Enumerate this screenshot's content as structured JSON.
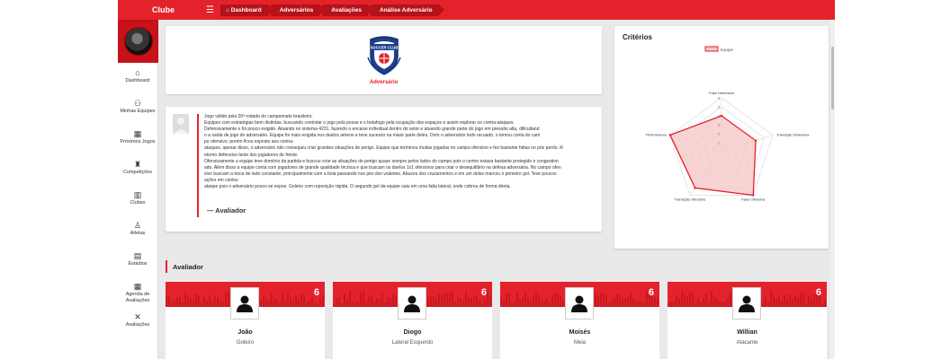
{
  "app": {
    "title": "Clube"
  },
  "breadcrumbs": [
    "Dashboard",
    "Adversários",
    "Avaliações",
    "Análise Adversário"
  ],
  "sidebar": {
    "items": [
      {
        "label": "Dashboard",
        "icon": "home-icon"
      },
      {
        "label": "Minhas Equipes",
        "icon": "team-icon"
      },
      {
        "label": "Próximos Jogos",
        "icon": "calendar-icon"
      },
      {
        "label": "Competições",
        "icon": "trophy-icon"
      },
      {
        "label": "Clubes",
        "icon": "building-icon"
      },
      {
        "label": "Atletas",
        "icon": "person-icon"
      },
      {
        "label": "Estádios",
        "icon": "stadium-icon"
      },
      {
        "label": "Agenda de Avaliações",
        "icon": "agenda-icon"
      },
      {
        "label": "Avaliações",
        "icon": "tools-icon"
      }
    ]
  },
  "opponent": {
    "label": "Adversário",
    "logo_text": "SOCCER CLUB"
  },
  "report": {
    "lines": [
      "Jogo válido pela 20ª rodada do campeonato brasileiro.",
      "Equipes com estratégias bem distintas.                     buscando controlar o jogo pela posse e o botafogo pela ocupação dos espaços e assim explorar os contra-ataques.",
      "Defensivamente o                     foi pouco exigido.  Atuando no sistema 4231, fazendo o encaixe individual dentro do setor e atuando grande parte do jogo em pressão alta, dificultand",
      "o a saída de jogo do adversário. Equipe foi mais exigida nos duelos aéreos e teve sucesso na maior parte deles.  Dom o adversário todo recuado, o                    tomou conta do cam",
      "po ofensivo, porém ficou exposto aos contra-",
      "ataques, apesar disso, o adversário não conseguiu criar grandes situações de perigo. Equipe que terminou muitas jogadas no campo ofensivo e fez bastante faltas no pós perdo. R",
      "etorno defensivo lento dos jogadores de frente.",
      "Ofensivamente a equipe teve domínio da partida e buscou criar as situações de perigo quase sempre pelos lados do campo pois o centro estava bastante protegido e congestion",
      "ado. Além disso a equipe conta com jogadores de grande qualidade técnica e que buscam os duelos 1x1 ofensivos para criar o desequilíbrio na defesa adversária. No campo ofen",
      "sivo buscam a troca de lado constante, principalmente com a bola passando nos pés dos volantes. Abusou dos cruzamentos e em um deles marcou o primeiro gol. Teve poucos",
      "ações em contra-",
      "ataque pois o adversário pouco se expos. Goleiro com reposição rápida. O segundo gol da equipe saiu em uma falta lateral, onde                   cobrou de forma direta."
    ],
    "author": "—  Avaliador"
  },
  "criteria": {
    "title": "Critérios"
  },
  "chart_data": {
    "type": "radar",
    "title": "Critérios",
    "series": [
      {
        "name": "Equipe",
        "values": [
          4,
          4,
          6,
          5,
          6
        ]
      }
    ],
    "categories": [
      "Fase Defensiva",
      "Transição Defensiva",
      "Fase Ofensiva",
      "Transição Ofensiva",
      "Performance"
    ],
    "scale": {
      "min": 0,
      "max": 6,
      "ticks": [
        1,
        2,
        3,
        4,
        5,
        6
      ]
    },
    "legend_position": "top",
    "colors": {
      "line": "#e4222b",
      "fill": "#f6c4c6"
    }
  },
  "evaluator_section": {
    "title": "Avaliador"
  },
  "players": [
    {
      "name": "João",
      "position": "Goleiro",
      "rating": "6"
    },
    {
      "name": "Diogo",
      "position": "Lateral Esquerdo",
      "rating": "6"
    },
    {
      "name": "Moisés",
      "position": "Meia",
      "rating": "6"
    },
    {
      "name": "Willian",
      "position": "Atacante",
      "rating": "6"
    }
  ],
  "colors": {
    "brand": "#e4222b",
    "brand_dark": "#b5121a"
  }
}
